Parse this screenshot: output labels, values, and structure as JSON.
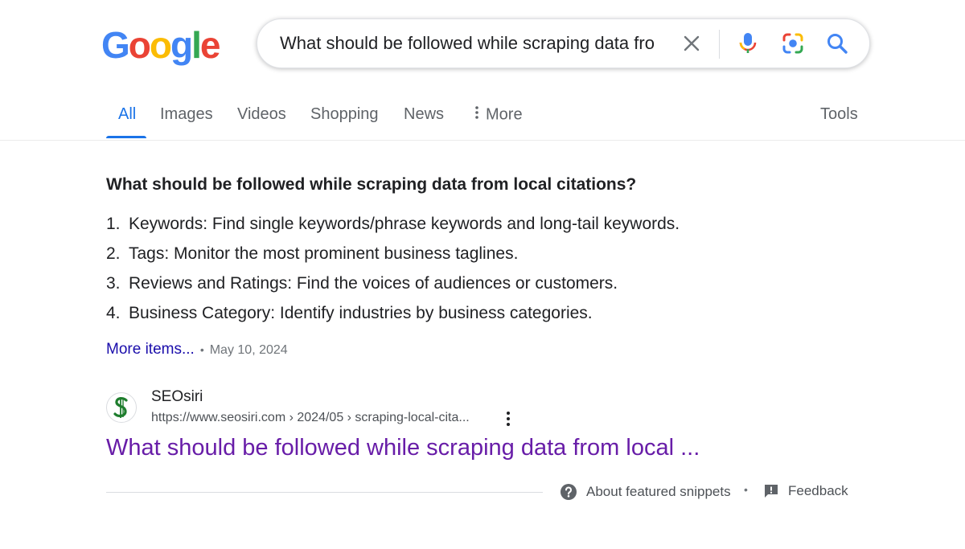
{
  "logo": {
    "letters": [
      "G",
      "o",
      "o",
      "g",
      "l",
      "e"
    ],
    "colors": [
      "#4285F4",
      "#EA4335",
      "#FBBC05",
      "#4285F4",
      "#34A853",
      "#EA4335"
    ]
  },
  "search": {
    "query": "What should be followed while scraping data fro"
  },
  "icons": {
    "clear": "close-icon",
    "mic": "microphone-icon",
    "lens": "google-lens-icon",
    "search": "search-icon"
  },
  "tabs": [
    {
      "label": "All",
      "active": true
    },
    {
      "label": "Images"
    },
    {
      "label": "Videos"
    },
    {
      "label": "Shopping"
    },
    {
      "label": "News"
    },
    {
      "label": "More"
    }
  ],
  "tools_label": "Tools",
  "snippet": {
    "title": "What should be followed while scraping data from local citations?",
    "items": [
      {
        "num": "1.",
        "text": "Keywords: Find single keywords/phrase keywords and long-tail keywords."
      },
      {
        "num": "2.",
        "text": "Tags: Monitor the most prominent business taglines."
      },
      {
        "num": "3.",
        "text": "Reviews and Ratings: Find the voices of audiences or customers."
      },
      {
        "num": "4.",
        "text": "Business Category: Identify industries by business categories."
      }
    ],
    "more_items": "More items...",
    "separator": "•",
    "date": "May 10, 2024"
  },
  "source": {
    "name": "SEOsiri",
    "url": "https://www.seosiri.com › 2024/05 › scraping-local-cita...",
    "title": "What should be followed while scraping data from local ..."
  },
  "footer": {
    "about": "About featured snippets",
    "separator": "•",
    "feedback": "Feedback"
  },
  "colors": {
    "accent": "#1a73e8",
    "link": "#1a0dab",
    "visited": "#681da8"
  }
}
